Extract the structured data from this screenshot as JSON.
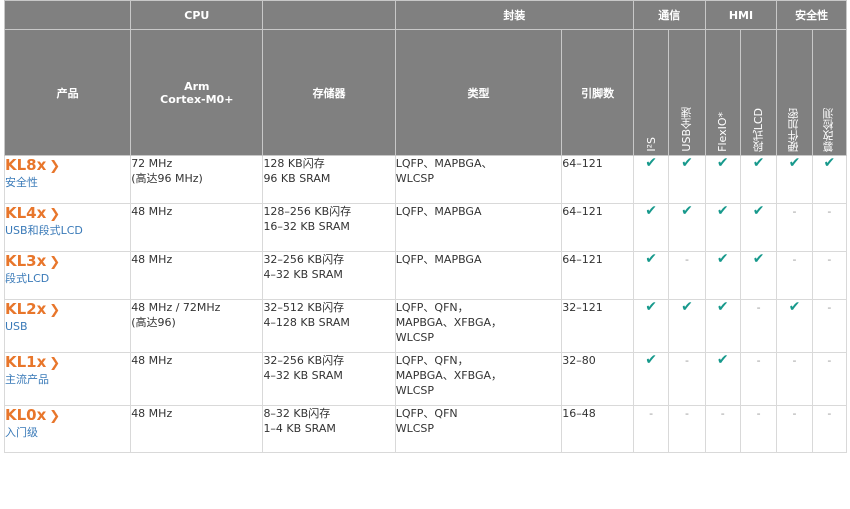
{
  "headers": {
    "cpu": "CPU",
    "package": "封装",
    "comm": "通信",
    "hmi": "HMI",
    "security": "安全性",
    "product": "产品",
    "core": "Arm\nCortex-M0+",
    "memory": "存储器",
    "type": "类型",
    "pins": "引脚数",
    "i2s": "I²S",
    "usb_fs": "USB全速",
    "flexio": "FlexIO*",
    "seg_lcd": "段式LCD",
    "hw_crypto": "硬件加密",
    "tamper": "篡改检测"
  },
  "rows": [
    {
      "name": "KL8x",
      "sub": "安全性",
      "core": "72 MHz\n(高达96 MHz)",
      "mem": "128 KB闪存\n96 KB SRAM",
      "pkg": "LQFP、MAPBGA、\nWLCSP",
      "pins": "64–121",
      "marks": [
        "check",
        "check",
        "check",
        "check",
        "check",
        "check"
      ]
    },
    {
      "name": "KL4x",
      "sub": "USB和段式LCD",
      "core": "48 MHz",
      "mem": "128–256 KB闪存\n16–32 KB SRAM",
      "pkg": "LQFP、MAPBGA",
      "pins": "64–121",
      "marks": [
        "check",
        "check",
        "check",
        "check",
        "-",
        "-"
      ]
    },
    {
      "name": "KL3x",
      "sub": "段式LCD",
      "core": "48 MHz",
      "mem": "32–256 KB闪存\n4–32 KB SRAM",
      "pkg": "LQFP、MAPBGA",
      "pins": "64–121",
      "marks": [
        "check",
        "-",
        "check",
        "check",
        "-",
        "-"
      ]
    },
    {
      "name": "KL2x",
      "sub": "USB",
      "core": "48 MHz / 72MHz\n(高达96)",
      "mem": "32–512 KB闪存\n4–128 KB SRAM",
      "pkg": "LQFP、QFN，\nMAPBGA、XFBGA，\nWLCSP",
      "pins": "32–121",
      "marks": [
        "check",
        "check",
        "check",
        "-",
        "check",
        "-"
      ]
    },
    {
      "name": "KL1x",
      "sub": "主流产品",
      "core": "48 MHz",
      "mem": "32–256 KB闪存\n4–32 KB SRAM",
      "pkg": "LQFP、QFN，\nMAPBGA、XFBGA，\nWLCSP",
      "pins": "32–80",
      "marks": [
        "check",
        "-",
        "check",
        "-",
        "-",
        "-"
      ]
    },
    {
      "name": "KL0x",
      "sub": "入门级",
      "core": "48 MHz",
      "mem": "8–32 KB闪存\n1–4 KB SRAM",
      "pkg": "LQFP、QFN\nWLCSP",
      "pins": "16–48",
      "marks": [
        "-",
        "-",
        "-",
        "-",
        "-",
        "-"
      ]
    }
  ],
  "colors": {
    "header_bg": "#808080",
    "product_name": "#e8762b",
    "product_sub": "#3a7ab8",
    "check": "#17998c"
  },
  "icons": {
    "check": "check-icon",
    "chevron": "chevron-right-icon"
  }
}
